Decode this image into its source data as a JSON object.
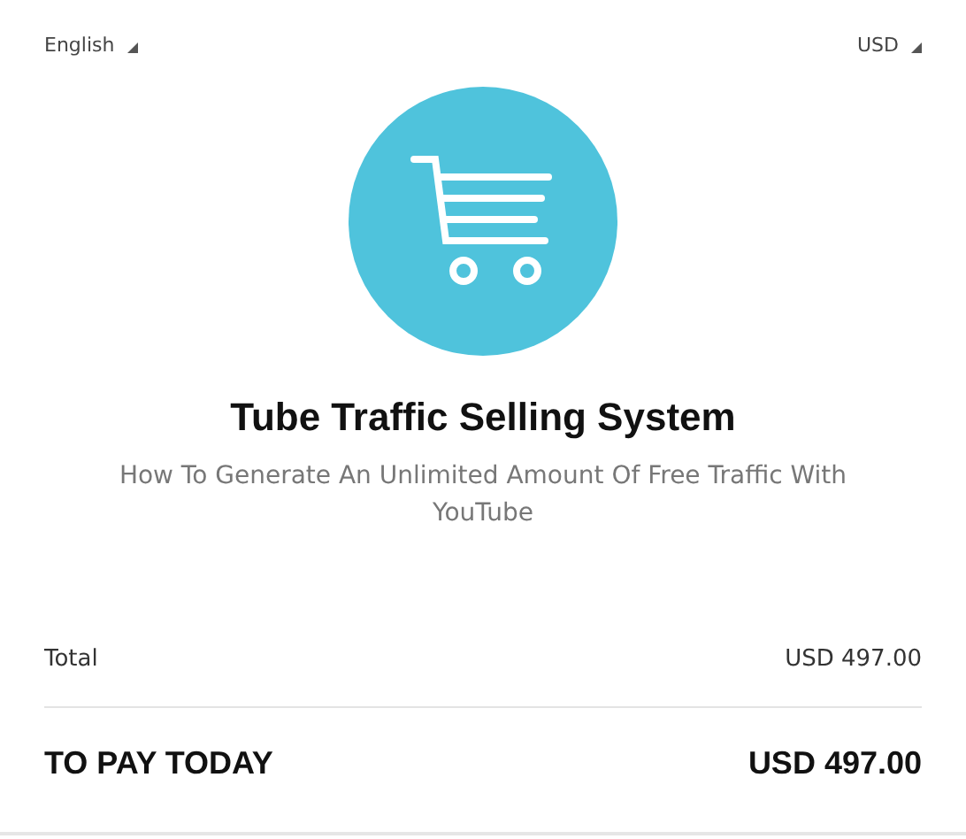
{
  "selectors": [
    {
      "label": "English"
    },
    {
      "label": "USD"
    }
  ],
  "product": {
    "title": "Tube Traffic Selling System",
    "subtitle": "How To Generate An Unlimited Amount Of Free Traffic With YouTube"
  },
  "summary": {
    "total_label": "Total",
    "total_value": "USD 497.00",
    "pay_label": "TO PAY TODAY",
    "pay_value": "USD 497.00"
  }
}
